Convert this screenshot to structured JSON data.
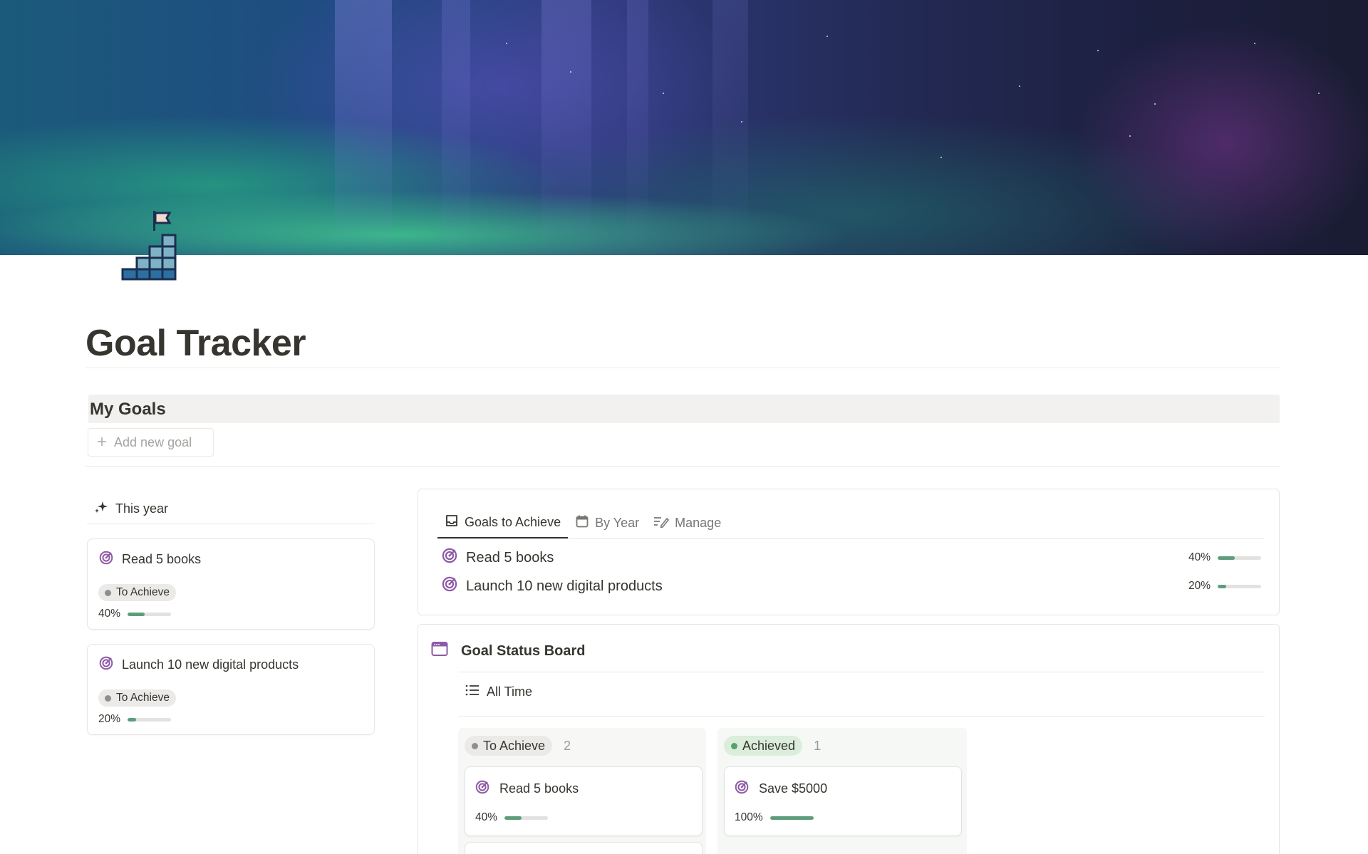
{
  "page": {
    "title": "Goal Tracker",
    "icon": "stairs-flag-icon"
  },
  "my_goals": {
    "heading": "My Goals",
    "add_button": "Add new goal"
  },
  "this_year": {
    "label": "This year",
    "cards": [
      {
        "name": "Read 5 books",
        "status": "To Achieve",
        "progress_text": "40%",
        "progress": 0.4
      },
      {
        "name": "Launch 10 new digital products",
        "status": "To Achieve",
        "progress_text": "20%",
        "progress": 0.2
      }
    ]
  },
  "goals_view": {
    "tabs": [
      {
        "label": "Goals to Achieve",
        "icon": "inbox-icon",
        "active": true
      },
      {
        "label": "By Year",
        "icon": "calendar-icon",
        "active": false
      },
      {
        "label": "Manage",
        "icon": "edit-list-icon",
        "active": false
      }
    ],
    "rows": [
      {
        "name": "Read 5 books",
        "progress_text": "40%",
        "progress": 0.4
      },
      {
        "name": "Launch 10 new digital products",
        "progress_text": "20%",
        "progress": 0.2
      }
    ]
  },
  "board": {
    "title": "Goal Status Board",
    "view": "All Time",
    "columns": [
      {
        "status": "To Achieve",
        "count": "2",
        "cards": [
          {
            "name": "Read 5 books",
            "progress_text": "40%",
            "progress": 0.4
          }
        ]
      },
      {
        "status": "Achieved",
        "count": "1",
        "cards": [
          {
            "name": "Save $5000",
            "progress_text": "100%",
            "progress": 1.0
          }
        ]
      }
    ]
  },
  "colors": {
    "progress_fill": "#5e9d7c",
    "target_icon": "#8e5aa6",
    "achieved_badge": "#dbeddb",
    "to_achieve_badge": "#ebeae8"
  }
}
